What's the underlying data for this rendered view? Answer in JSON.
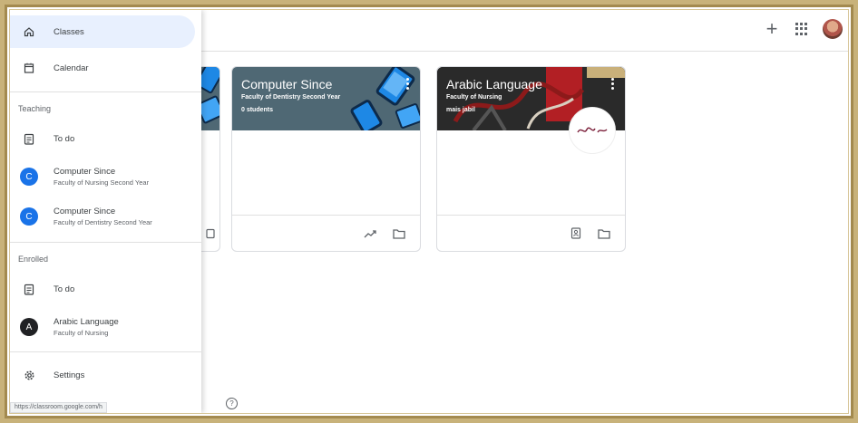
{
  "sidebar": {
    "classes_label": "Classes",
    "calendar_label": "Calendar",
    "teaching_label": "Teaching",
    "teaching": {
      "todo_label": "To do",
      "classes": [
        {
          "initial": "C",
          "name": "Computer Since",
          "section": "Faculty of Nursing Second Year",
          "color": "#1a73e8"
        },
        {
          "initial": "C",
          "name": "Computer Since",
          "section": "Faculty of Dentistry Second Year",
          "color": "#1a73e8"
        }
      ]
    },
    "enrolled_label": "Enrolled",
    "enrolled": {
      "todo_label": "To do",
      "classes": [
        {
          "initial": "A",
          "name": "Arabic Language",
          "section": "Faculty of Nursing",
          "color": "#202124"
        }
      ]
    },
    "settings_label": "Settings"
  },
  "cards": [
    {
      "title": "Computer Since",
      "section": "Faculty of Dentistry Second Year",
      "info": "0 students",
      "color": "#4f6874"
    },
    {
      "title": "Arabic Language",
      "section": "Faculty of Nursing",
      "info": "mais jabil",
      "color": "#2b2b2b"
    }
  ],
  "status_url": "https://classroom.google.com/h",
  "icons": {
    "home": "home-icon",
    "calendar": "calendar-icon",
    "todo": "assignment-icon",
    "settings": "gear-icon",
    "trend": "trending-icon",
    "folder": "folder-icon",
    "gradebook": "person-book-icon",
    "help": "help-icon",
    "add": "plus-icon",
    "apps": "apps-grid-icon"
  }
}
